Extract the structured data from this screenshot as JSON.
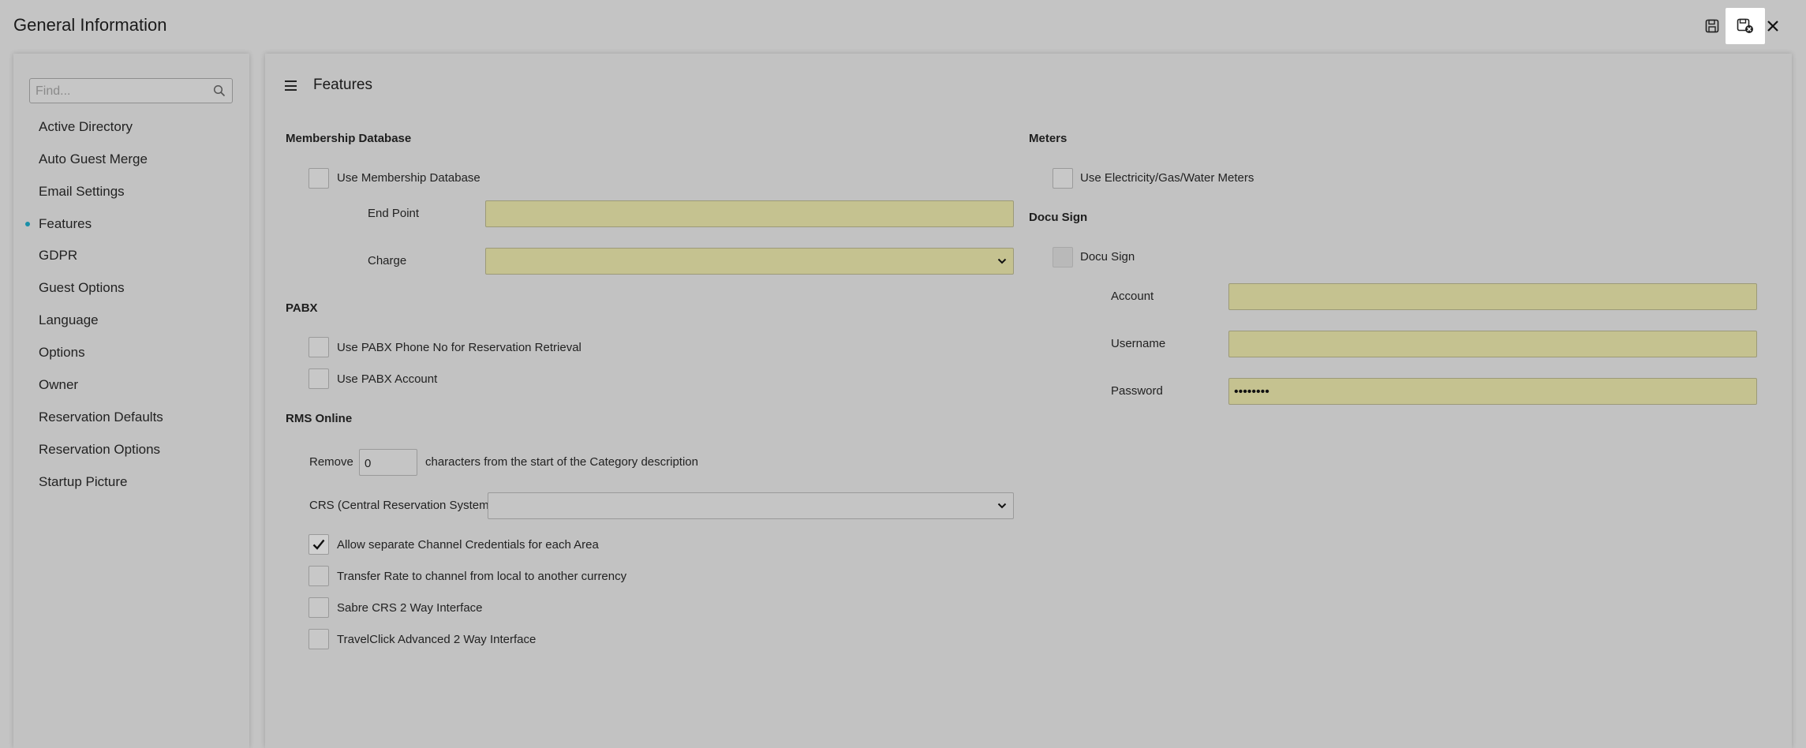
{
  "header": {
    "title": "General Information",
    "buttons": [
      {
        "name": "save-icon"
      },
      {
        "name": "save-and-close-icon"
      },
      {
        "name": "close-icon"
      }
    ]
  },
  "sidebar": {
    "search_placeholder": "Find...",
    "items": [
      {
        "label": "Active Directory"
      },
      {
        "label": "Auto Guest Merge"
      },
      {
        "label": "Email Settings"
      },
      {
        "label": "Features",
        "active": true
      },
      {
        "label": "GDPR"
      },
      {
        "label": "Guest Options"
      },
      {
        "label": "Language"
      },
      {
        "label": "Options"
      },
      {
        "label": "Owner"
      },
      {
        "label": "Reservation Defaults"
      },
      {
        "label": "Reservation Options"
      },
      {
        "label": "Startup Picture"
      }
    ]
  },
  "main": {
    "title": "Features",
    "membership": {
      "title": "Membership Database",
      "use_label": "Use Membership Database",
      "use_checked": false,
      "end_point_label": "End Point",
      "end_point_value": "",
      "charge_label": "Charge",
      "charge_value": ""
    },
    "pabx": {
      "title": "PABX",
      "phone_label": "Use PABX Phone No for Reservation Retrieval",
      "phone_checked": false,
      "account_label": "Use PABX Account",
      "account_checked": false
    },
    "rms_online": {
      "title": "RMS Online",
      "remove_label": "Remove",
      "remove_value": "0",
      "remove_suffix": "characters from the start of the Category description",
      "crs_label": "CRS (Central Reservation System)",
      "crs_value": "",
      "options": [
        {
          "label": "Allow separate Channel Credentials for each Area",
          "checked": true
        },
        {
          "label": "Transfer Rate to channel from local to another currency",
          "checked": false
        },
        {
          "label": "Sabre CRS 2 Way Interface",
          "checked": false
        },
        {
          "label": "TravelClick Advanced 2 Way Interface",
          "checked": false
        }
      ]
    },
    "meters": {
      "title": "Meters",
      "use_label": "Use Electricity/Gas/Water Meters",
      "use_checked": false
    },
    "docu_sign": {
      "title": "Docu Sign",
      "enable_label": "Docu Sign",
      "enable_checked": false,
      "account_label": "Account",
      "account_value": "",
      "username_label": "Username",
      "username_value": "",
      "password_label": "Password",
      "password_value": "••••••••"
    }
  },
  "colors": {
    "accent": "#1a8fa8",
    "required_field": "#c5c290",
    "background": "#c4c4c4"
  }
}
